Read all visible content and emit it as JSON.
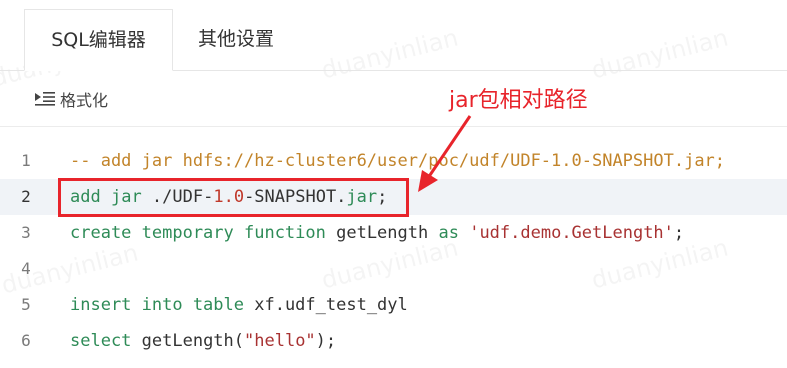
{
  "tabs": [
    {
      "label": "SQL编辑器",
      "active": true
    },
    {
      "label": "其他设置",
      "active": false
    }
  ],
  "toolbar": {
    "format_label": "格式化",
    "format_icon": "format-indent-icon"
  },
  "editor": {
    "active_line": 2,
    "lines": [
      {
        "number": "1",
        "segments": [
          {
            "type": "cm",
            "text": "-- add jar hdfs://hz-cluster6/user/poc/udf/UDF-1.0-SNAPSHOT.jar;"
          }
        ]
      },
      {
        "number": "2",
        "segments": [
          {
            "type": "kw",
            "text": "add"
          },
          {
            "type": "plain",
            "text": " "
          },
          {
            "type": "kw",
            "text": "jar"
          },
          {
            "type": "plain",
            "text": " ./UDF-"
          },
          {
            "type": "num",
            "text": "1.0"
          },
          {
            "type": "plain",
            "text": "-SNAPSHOT."
          },
          {
            "type": "kw",
            "text": "jar"
          },
          {
            "type": "plain",
            "text": ";"
          }
        ]
      },
      {
        "number": "3",
        "segments": [
          {
            "type": "kw",
            "text": "create temporary function"
          },
          {
            "type": "plain",
            "text": " getLength "
          },
          {
            "type": "kw",
            "text": "as"
          },
          {
            "type": "plain",
            "text": " "
          },
          {
            "type": "str",
            "text": "'udf.demo.GetLength'"
          },
          {
            "type": "plain",
            "text": ";"
          }
        ]
      },
      {
        "number": "4",
        "segments": []
      },
      {
        "number": "5",
        "segments": [
          {
            "type": "kw",
            "text": "insert into table"
          },
          {
            "type": "plain",
            "text": " xf.udf_test_dyl"
          }
        ]
      },
      {
        "number": "6",
        "segments": [
          {
            "type": "kw",
            "text": "select"
          },
          {
            "type": "plain",
            "text": " getLength("
          },
          {
            "type": "str",
            "text": "\"hello\""
          },
          {
            "type": "plain",
            "text": ");"
          }
        ]
      }
    ]
  },
  "annotation": {
    "text": "jar包相对路径",
    "color": "#e8242b"
  },
  "watermark": "duanyinlian"
}
